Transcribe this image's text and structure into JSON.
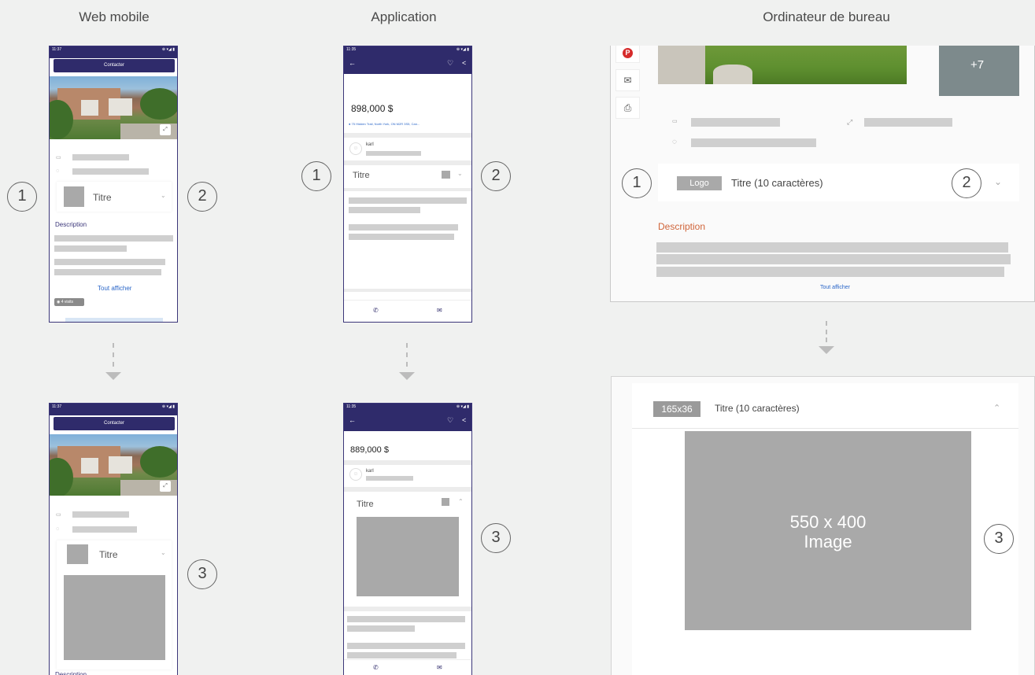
{
  "columns": {
    "web_mobile": "Web mobile",
    "application": "Application",
    "desktop": "Ordinateur de bureau"
  },
  "markers": [
    "1",
    "2",
    "3"
  ],
  "web": {
    "time": "11:37",
    "status_icons": "⊕ ▾◢ ▮",
    "contact_label": "Contacter",
    "titre": "Titre",
    "description_label": "Description",
    "show_all": "Tout afficher",
    "visits": "4 visits"
  },
  "app": {
    "time_top": "11:35",
    "time_bottom": "11:35",
    "status_icons": "⊕ ▾◢ ▮",
    "price_top": "898,000 $",
    "price_bottom": "889,000 $",
    "address": "75 Hidden Trail, North York, ON M2R 3S5, Can...",
    "agent_name": "karl",
    "titre": "Titre"
  },
  "desktop": {
    "photo_more": "+7",
    "logo_label": "Logo",
    "title_text": "Titre (10 caractères)",
    "description_label": "Description",
    "show_all": "Tout afficher",
    "logo_size": "165x36",
    "image_size": "550 x 400",
    "image_word": "Image"
  },
  "colors": {
    "brand": "#2f2b6b",
    "accent_orange": "#d0653a",
    "link_blue": "#2a66c8",
    "placeholder": "#a9a9a9"
  }
}
